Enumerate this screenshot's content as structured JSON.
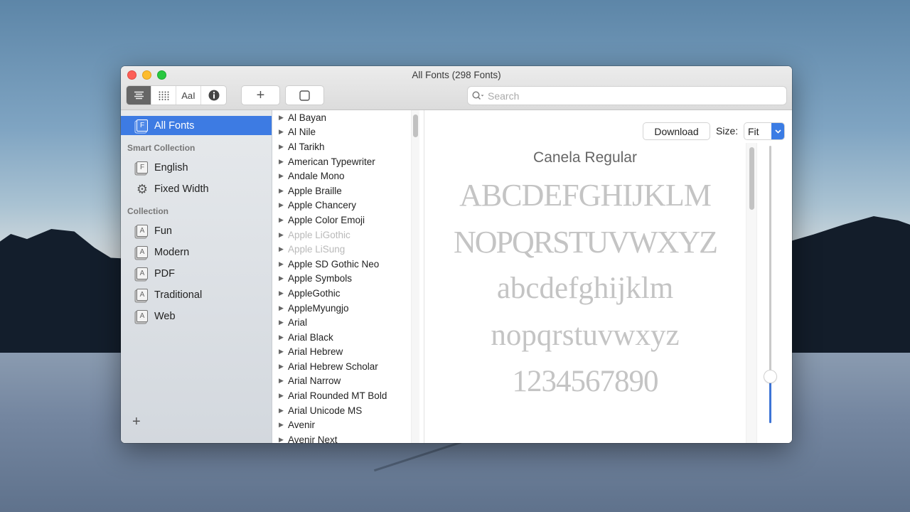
{
  "window": {
    "title": "All Fonts (298 Fonts)"
  },
  "toolbar": {
    "view_buttons": [
      {
        "name": "list-view",
        "icon": "list-icon",
        "glyph": "☰",
        "active": true
      },
      {
        "name": "grid-view",
        "icon": "grid-icon",
        "glyph": "⠿",
        "active": false
      },
      {
        "name": "sample-view",
        "icon": "sample-text-icon",
        "glyph": "AaI",
        "active": false
      },
      {
        "name": "info-view",
        "icon": "info-icon",
        "glyph": "i",
        "active": false
      }
    ],
    "add_button_glyph": "+",
    "deactivate_button_glyph": "▢",
    "search_placeholder": "Search",
    "search_value": ""
  },
  "sidebar": {
    "all_fonts": {
      "label": "All Fonts",
      "icon": "F",
      "selected": true
    },
    "smart_collection_header": "Smart Collection",
    "smart_collections": [
      {
        "label": "English",
        "icon": "F",
        "type": "font-book"
      },
      {
        "label": "Fixed Width",
        "icon": "⚙",
        "type": "gear"
      }
    ],
    "collection_header": "Collection",
    "collections": [
      {
        "label": "Fun",
        "icon": "A"
      },
      {
        "label": "Modern",
        "icon": "A"
      },
      {
        "label": "PDF",
        "icon": "A"
      },
      {
        "label": "Traditional",
        "icon": "A"
      },
      {
        "label": "Web",
        "icon": "A"
      }
    ],
    "add_glyph": "+"
  },
  "font_list": {
    "items": [
      {
        "label": "Al Bayan",
        "disabled": false
      },
      {
        "label": "Al Nile",
        "disabled": false
      },
      {
        "label": "Al Tarikh",
        "disabled": false
      },
      {
        "label": "American Typewriter",
        "disabled": false
      },
      {
        "label": "Andale Mono",
        "disabled": false
      },
      {
        "label": "Apple Braille",
        "disabled": false
      },
      {
        "label": "Apple Chancery",
        "disabled": false
      },
      {
        "label": "Apple Color Emoji",
        "disabled": false
      },
      {
        "label": "Apple LiGothic",
        "disabled": true
      },
      {
        "label": "Apple LiSung",
        "disabled": true
      },
      {
        "label": "Apple SD Gothic Neo",
        "disabled": false
      },
      {
        "label": "Apple Symbols",
        "disabled": false
      },
      {
        "label": "AppleGothic",
        "disabled": false
      },
      {
        "label": "AppleMyungjo",
        "disabled": false
      },
      {
        "label": "Arial",
        "disabled": false
      },
      {
        "label": "Arial Black",
        "disabled": false
      },
      {
        "label": "Arial Hebrew",
        "disabled": false
      },
      {
        "label": "Arial Hebrew Scholar",
        "disabled": false
      },
      {
        "label": "Arial Narrow",
        "disabled": false
      },
      {
        "label": "Arial Rounded MT Bold",
        "disabled": false
      },
      {
        "label": "Arial Unicode MS",
        "disabled": false
      },
      {
        "label": "Avenir",
        "disabled": false
      },
      {
        "label": "Avenir Next",
        "disabled": false
      }
    ],
    "expand_glyph": "▶"
  },
  "preview": {
    "download_label": "Download",
    "size_label": "Size:",
    "size_value": "Fit",
    "font_name": "Canela Regular",
    "sample_lines": [
      "ABCDEFGHIJKLM",
      "NOPQRSTUVWXYZ",
      "abcdefghijklm",
      "nopqrstuvwxyz",
      "1234567890"
    ],
    "size_slider_fraction": 0.17,
    "accent_color": "#3d7be3"
  }
}
